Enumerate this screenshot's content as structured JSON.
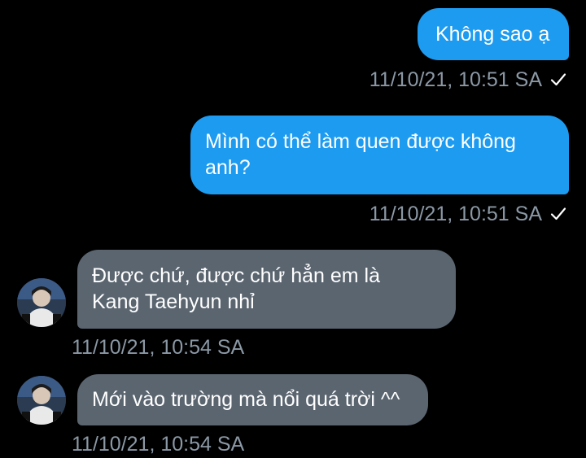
{
  "messages": [
    {
      "direction": "outgoing",
      "text": "Không sao ạ",
      "timestamp": "11/10/21, 10:51 SA",
      "status_icon": "checkmark-icon"
    },
    {
      "direction": "outgoing",
      "text_lines": [
        "Mình có thể làm quen được không",
        "anh?"
      ],
      "timestamp": "11/10/21, 10:51 SA",
      "status_icon": "checkmark-icon"
    },
    {
      "direction": "incoming",
      "text_lines": [
        "Được chứ, được chứ hẳn em là",
        "Kang Taehyun nhỉ"
      ],
      "timestamp": "11/10/21, 10:54 SA",
      "avatar_icon": "user-avatar-icon"
    },
    {
      "direction": "incoming",
      "text": "Mới vào trường mà nổi quá trời ^^",
      "timestamp": "11/10/21, 10:54 SA",
      "avatar_icon": "user-avatar-icon"
    }
  ],
  "colors": {
    "background": "#000000",
    "outgoing_bubble": "#1d9bf0",
    "incoming_bubble": "#5b6570",
    "timestamp": "#8b98a5"
  }
}
